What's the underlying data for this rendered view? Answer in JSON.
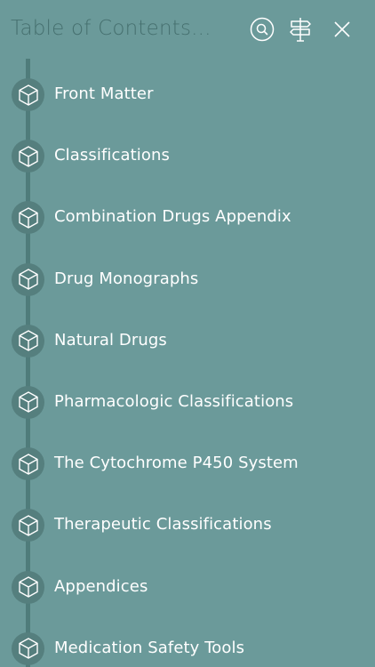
{
  "header": {
    "title": "Table of Contents...",
    "icons": {
      "search": "search-icon",
      "signpost": "signpost-icon",
      "close": "close-icon"
    }
  },
  "colors": {
    "background": "#6b9a9a",
    "title_text": "#46706f",
    "timeline": "#4f7c7b",
    "node_fill": "#557f7e",
    "item_text": "#ffffff"
  },
  "toc": {
    "item_icon": "cube-icon",
    "items": [
      {
        "label": "Front Matter"
      },
      {
        "label": "Classifications"
      },
      {
        "label": "Combination Drugs Appendix"
      },
      {
        "label": "Drug Monographs"
      },
      {
        "label": "Natural Drugs"
      },
      {
        "label": "Pharmacologic Classifications"
      },
      {
        "label": "The Cytochrome P450 System"
      },
      {
        "label": "Therapeutic Classifications"
      },
      {
        "label": "Appendices"
      },
      {
        "label": "Medication Safety Tools"
      }
    ]
  }
}
